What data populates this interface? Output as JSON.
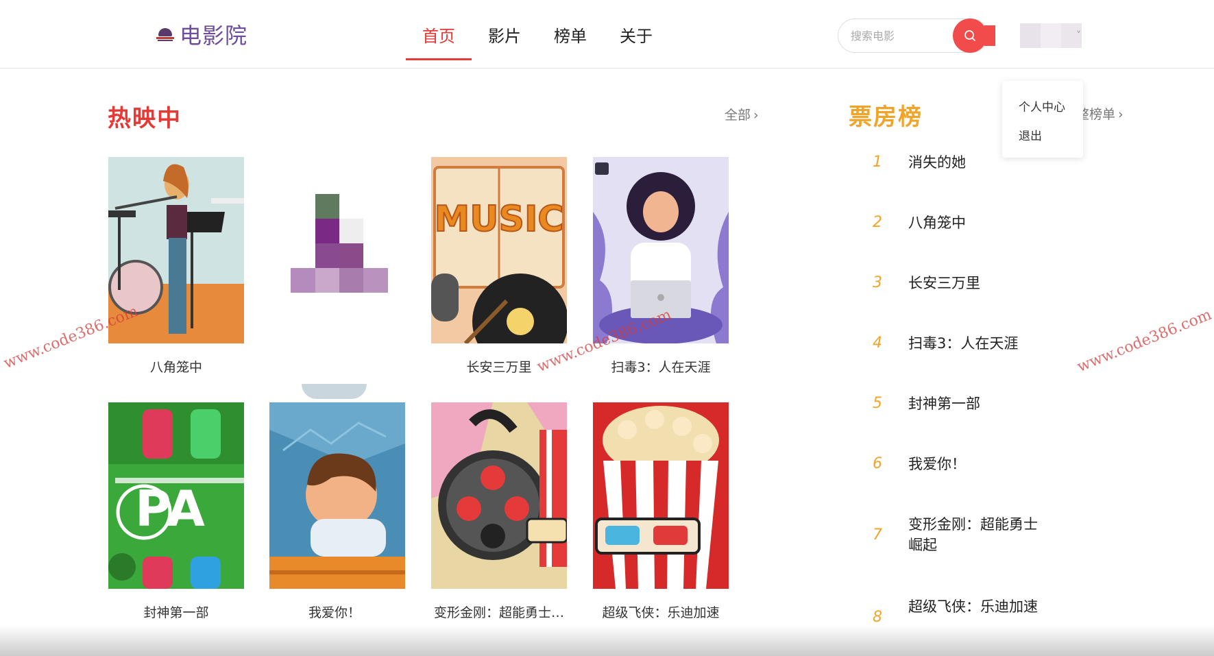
{
  "header": {
    "logo_text": "电影院",
    "nav": [
      {
        "label": "首页",
        "active": true
      },
      {
        "label": "影片",
        "active": false
      },
      {
        "label": "榜单",
        "active": false
      },
      {
        "label": "关于",
        "active": false
      }
    ],
    "search_placeholder": "搜索电影",
    "user_menu": [
      "个人中心",
      "退出"
    ]
  },
  "now_showing": {
    "title": "热映中",
    "more_label": "全部",
    "movies": [
      {
        "name": "八角笼中",
        "poster_icon": "flute-player-illustration"
      },
      {
        "name": "",
        "poster_icon": "pixelated-image"
      },
      {
        "name": "长安三万里",
        "poster_icon": "music-book-illustration"
      },
      {
        "name": "扫毒3：人在天涯",
        "poster_icon": "woman-laptop-illustration"
      },
      {
        "name": "封神第一部",
        "poster_icon": "parking-lot-illustration"
      },
      {
        "name": "我爱你！",
        "poster_icon": "boy-drawing-illustration"
      },
      {
        "name": "变形金刚：超能勇士…",
        "poster_icon": "film-reel-illustration"
      },
      {
        "name": "超级飞侠：乐迪加速",
        "poster_icon": "popcorn-illustration"
      }
    ]
  },
  "box_office": {
    "title": "票房榜",
    "more_label": "整榜单",
    "ranks": [
      {
        "rank": "1",
        "name": "消失的她"
      },
      {
        "rank": "2",
        "name": "八角笼中"
      },
      {
        "rank": "3",
        "name": "长安三万里"
      },
      {
        "rank": "4",
        "name": "扫毒3：人在天涯"
      },
      {
        "rank": "5",
        "name": "封神第一部"
      },
      {
        "rank": "6",
        "name": "我爱你！"
      },
      {
        "rank": "7",
        "name": "变形金刚：超能勇士崛起"
      },
      {
        "rank": "8",
        "name": "超级飞侠：乐迪加速"
      }
    ]
  },
  "watermark_text": "www.code386.com",
  "colors": {
    "accent_red": "#e53935",
    "rank_gold": "#f0a52a",
    "logo_purple": "#6d4e9c"
  }
}
